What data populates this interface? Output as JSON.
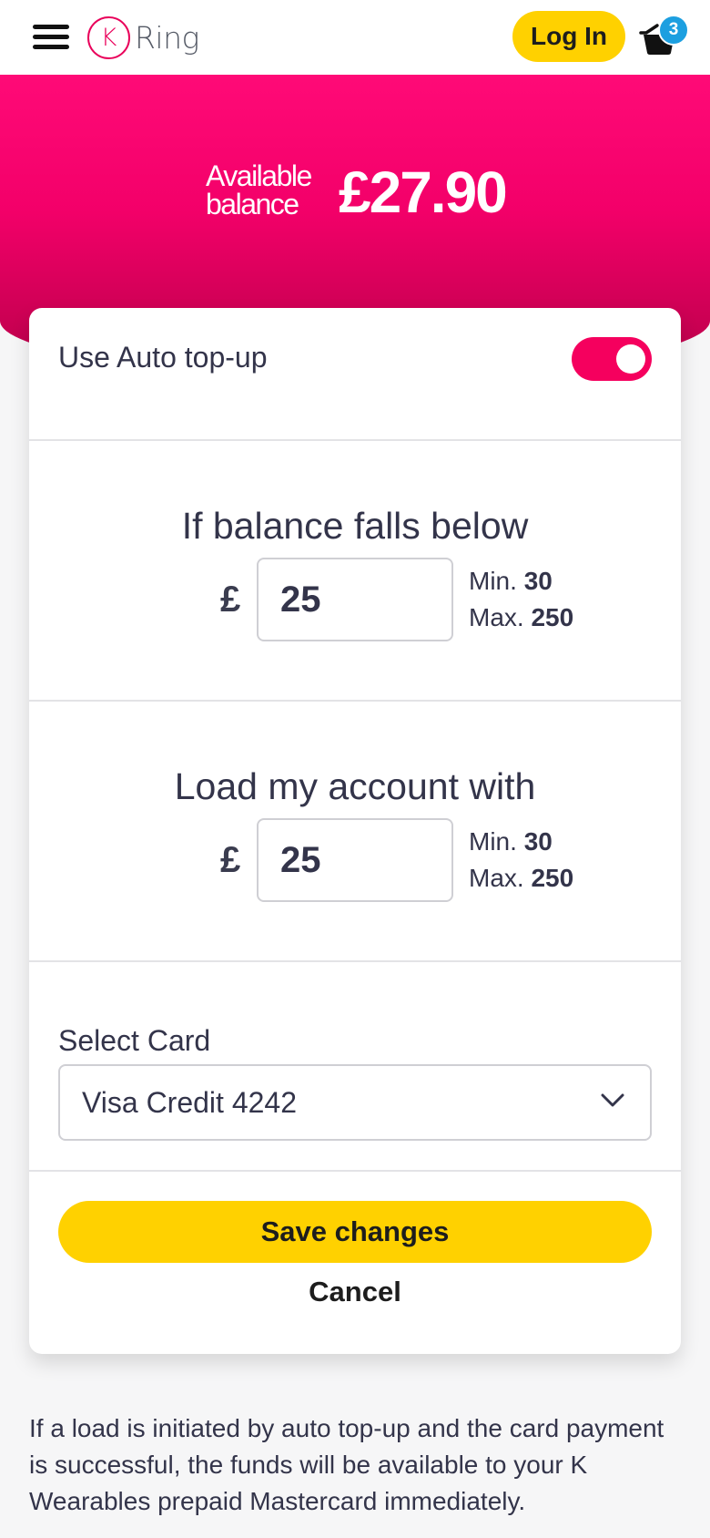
{
  "header": {
    "logo_letter": "K",
    "logo_text": "Ring",
    "login_label": "Log In",
    "cart_count": "3"
  },
  "hero": {
    "balance_label": "Available balance",
    "balance_amount": "£27.90"
  },
  "auto_topup": {
    "label": "Use Auto top-up",
    "enabled": true
  },
  "threshold": {
    "title": "If balance falls below",
    "currency": "£",
    "value": "25",
    "min_label": "Min.",
    "min_value": "30",
    "max_label": "Max.",
    "max_value": "250"
  },
  "load_amount": {
    "title": "Load my account with",
    "currency": "£",
    "value": "25",
    "min_label": "Min.",
    "min_value": "30",
    "max_label": "Max.",
    "max_value": "250"
  },
  "card_select": {
    "label": "Select Card",
    "selected": "Visa Credit 4242"
  },
  "actions": {
    "save_label": "Save changes",
    "cancel_label": "Cancel"
  },
  "footnote": "If a load is initiated by auto top-up and the card payment is successful, the funds will be available to your K Wearables prepaid Mastercard immediately.",
  "colors": {
    "brand_pink": "#f5005e",
    "accent_yellow": "#ffd100",
    "badge_blue": "#1c9fe0"
  }
}
